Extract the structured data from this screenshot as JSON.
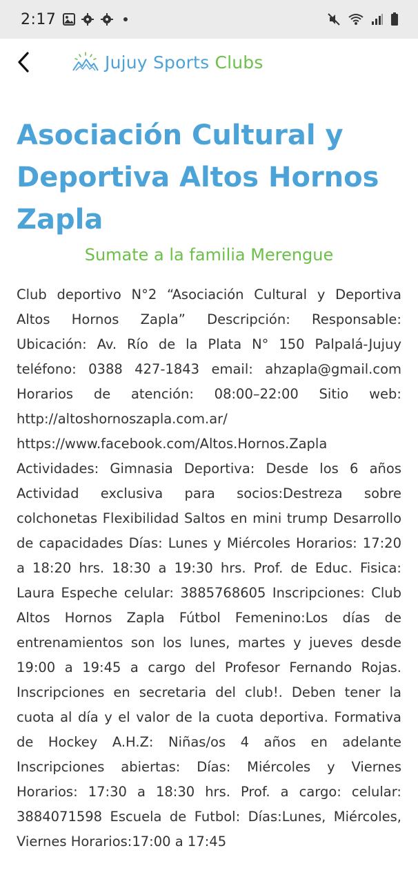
{
  "status_bar": {
    "time": "2:17",
    "icons_left": [
      "gallery-icon",
      "settings-icon",
      "settings-icon"
    ],
    "icons_right": [
      "mute-icon",
      "wifi-icon",
      "signal-icon",
      "battery-icon"
    ]
  },
  "header": {
    "back_icon": "chevron-left-icon",
    "logo_part1": "Jujuy Sports ",
    "logo_part2": "Clubs",
    "brand_blue": "#4ba3d8",
    "brand_green": "#6cc04a"
  },
  "page": {
    "title": "Asociación Cultural y Deportiva Altos Hornos Zapla",
    "tagline": "Sumate a la familia Merengue",
    "body": "Club deportivo N°2 “Asociación Cultural y Deportiva Altos Hornos Zapla” Descripción: Responsable: Ubicación: Av. Río de la Plata N° 150 Palpalá-Jujuy teléfono: 0388 427-1843 email: ahzapla@gmail.com Horarios de atención: 08:00–22:00 Sitio web: http://altoshornoszapla.com.ar/ https://www.facebook.com/Altos.Hornos.Zapla Actividades: Gimnasia Deportiva: Desde los 6 años Actividad exclusiva para socios:Destreza sobre colchonetas Flexibilidad Saltos en mini trump Desarrollo de capacidades Días: Lunes y Miércoles Horarios: 17:20 a 18:20 hrs. 18:30 a 19:30 hrs. Prof. de Educ. Fisica: Laura Espeche celular: 3885768605 Inscripciones: Club Altos Hornos Zapla Fútbol Femenino:Los días de entrenamientos son los lunes, martes y jueves desde 19:00 a 19:45 a cargo del Profesor Fernando Rojas. Inscripciones en secretaria del club!. Deben tener la cuota al día y el valor de la cuota deportiva. Formativa de Hockey A.H.Z: Niñas/os 4 años en adelante Inscripciones abiertas: Días: Miércoles y Viernes Horarios: 17:30 a 18:30 hrs. Prof. a cargo: celular: 3884071598 Escuela de Futbol: Días:Lunes, Miércoles, Viernes Horarios:17:00 a 17:45"
  }
}
